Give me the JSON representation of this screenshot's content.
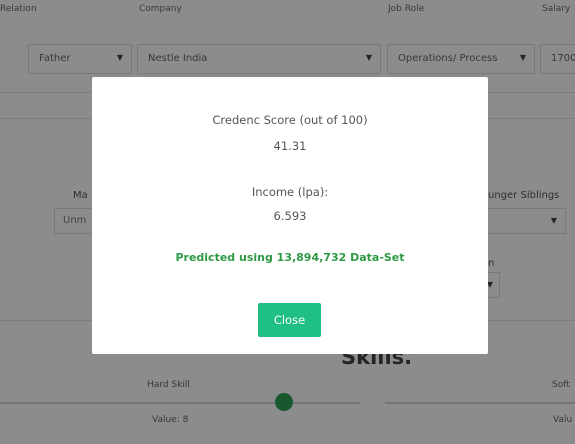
{
  "table": {
    "headers": {
      "relation": "Relation",
      "company": "Company",
      "job_role": "Job Role",
      "salary": "Salary"
    },
    "row": {
      "relation": "Father",
      "company": "Nestle India",
      "job_role": "Operations/ Process",
      "salary": "1700"
    }
  },
  "middle": {
    "marital_label_partial": "Ma",
    "marital_value_partial": "Unm",
    "siblings_label_partial": "unger Siblings",
    "other_label_partial": "n"
  },
  "skills": {
    "title": "Skills.",
    "hard_label": "Hard Skill",
    "hard_value": "Value: 8",
    "soft_label_partial": "Soft",
    "soft_value_partial": "Valu"
  },
  "modal": {
    "score_label": "Credenc Score (out of 100)",
    "score_value": "41.31",
    "income_label": "Income (lpa):",
    "income_value": "6.593",
    "prediction_note": "Predicted using 13,894,732 Data-Set",
    "close_label": "Close"
  },
  "colors": {
    "accent_button": "#1fbf86",
    "prediction_text": "#2e9a45",
    "slider_knob": "#2f9e57"
  }
}
